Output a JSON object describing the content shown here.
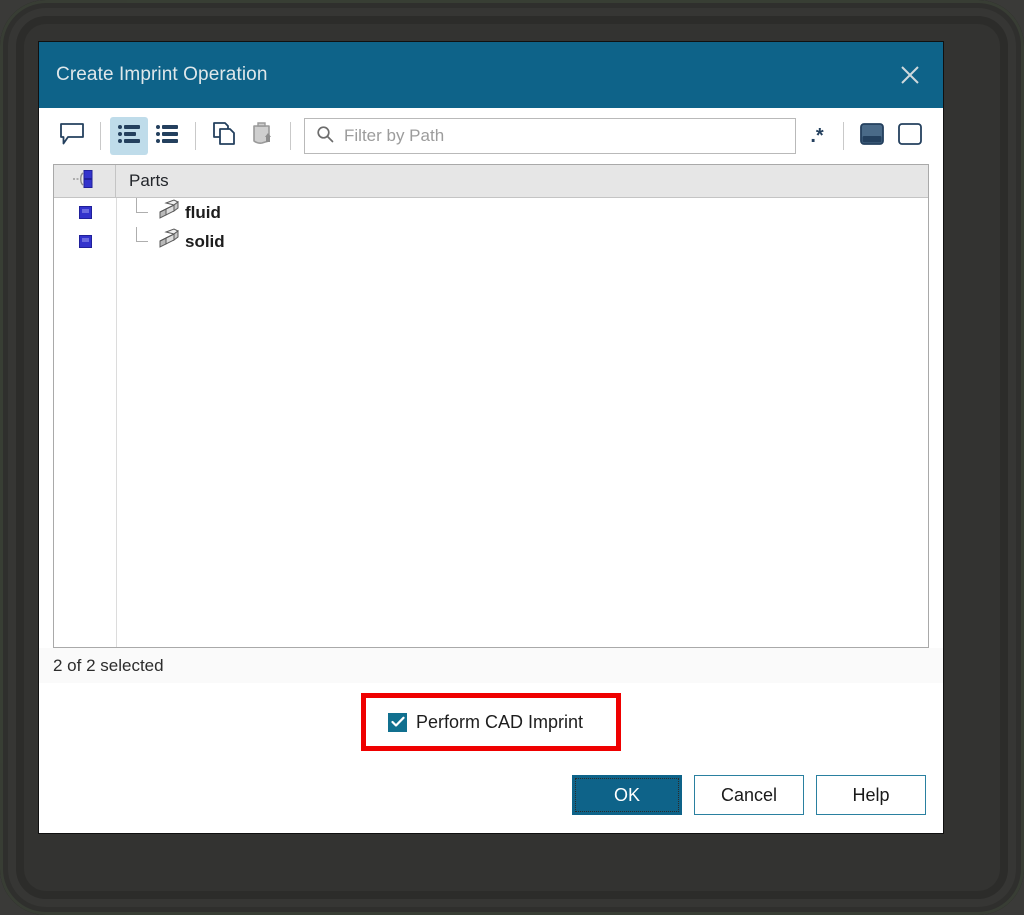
{
  "window": {
    "title": "Create Imprint Operation",
    "close_icon": "close-icon",
    "accent_color": "#0e6389",
    "highlight_color": "#ef0000"
  },
  "toolbar": {
    "buttons": [
      {
        "name": "comment-icon",
        "tooltip": "Comment"
      },
      {
        "name": "detail-list-icon",
        "tooltip": "Detail List",
        "active": true
      },
      {
        "name": "simple-list-icon",
        "tooltip": "Simple List",
        "active": false
      },
      {
        "name": "copy-icon",
        "tooltip": "Copy"
      },
      {
        "name": "paste-icon",
        "tooltip": "Paste",
        "disabled": true
      }
    ],
    "regex_label": ".*",
    "view_buttons": [
      {
        "name": "filled-panel-icon",
        "active": true
      },
      {
        "name": "empty-panel-icon",
        "active": false
      }
    ]
  },
  "search": {
    "placeholder": "Filter by Path",
    "value": "",
    "icon": "search-icon"
  },
  "tree": {
    "header": {
      "select_all_icon": "select-all-icon",
      "column_label": "Parts"
    },
    "rows": [
      {
        "label": "fluid",
        "selected": true,
        "icon": "part-icon"
      },
      {
        "label": "solid",
        "selected": true,
        "icon": "part-icon"
      }
    ]
  },
  "status": {
    "text": "2 of 2 selected"
  },
  "options": {
    "perform_cad_imprint": {
      "label": "Perform CAD Imprint",
      "checked": true
    }
  },
  "buttons": {
    "ok": "OK",
    "cancel": "Cancel",
    "help": "Help"
  }
}
